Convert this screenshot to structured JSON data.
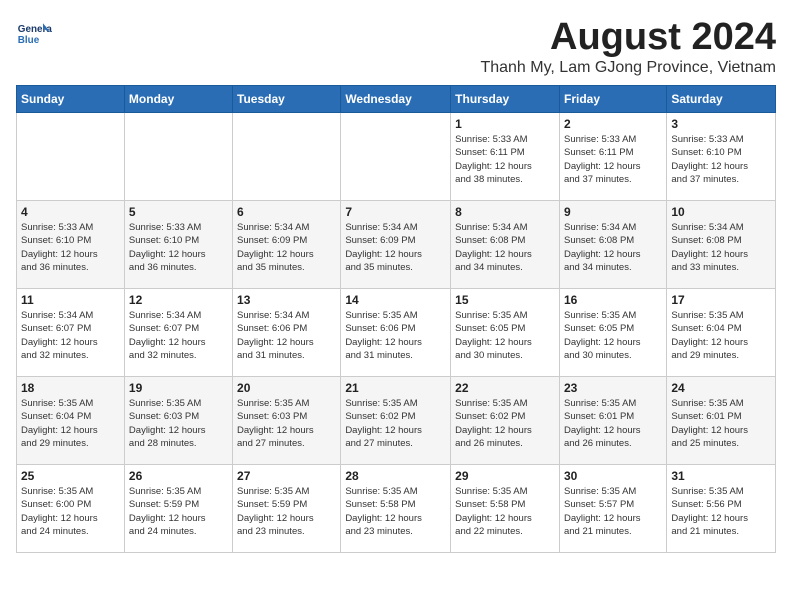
{
  "header": {
    "logo_line1": "General",
    "logo_line2": "Blue",
    "month_year": "August 2024",
    "location": "Thanh My, Lam GJong Province, Vietnam"
  },
  "weekdays": [
    "Sunday",
    "Monday",
    "Tuesday",
    "Wednesday",
    "Thursday",
    "Friday",
    "Saturday"
  ],
  "weeks": [
    [
      {
        "day": "",
        "info": ""
      },
      {
        "day": "",
        "info": ""
      },
      {
        "day": "",
        "info": ""
      },
      {
        "day": "",
        "info": ""
      },
      {
        "day": "1",
        "info": "Sunrise: 5:33 AM\nSunset: 6:11 PM\nDaylight: 12 hours\nand 38 minutes."
      },
      {
        "day": "2",
        "info": "Sunrise: 5:33 AM\nSunset: 6:11 PM\nDaylight: 12 hours\nand 37 minutes."
      },
      {
        "day": "3",
        "info": "Sunrise: 5:33 AM\nSunset: 6:10 PM\nDaylight: 12 hours\nand 37 minutes."
      }
    ],
    [
      {
        "day": "4",
        "info": "Sunrise: 5:33 AM\nSunset: 6:10 PM\nDaylight: 12 hours\nand 36 minutes."
      },
      {
        "day": "5",
        "info": "Sunrise: 5:33 AM\nSunset: 6:10 PM\nDaylight: 12 hours\nand 36 minutes."
      },
      {
        "day": "6",
        "info": "Sunrise: 5:34 AM\nSunset: 6:09 PM\nDaylight: 12 hours\nand 35 minutes."
      },
      {
        "day": "7",
        "info": "Sunrise: 5:34 AM\nSunset: 6:09 PM\nDaylight: 12 hours\nand 35 minutes."
      },
      {
        "day": "8",
        "info": "Sunrise: 5:34 AM\nSunset: 6:08 PM\nDaylight: 12 hours\nand 34 minutes."
      },
      {
        "day": "9",
        "info": "Sunrise: 5:34 AM\nSunset: 6:08 PM\nDaylight: 12 hours\nand 34 minutes."
      },
      {
        "day": "10",
        "info": "Sunrise: 5:34 AM\nSunset: 6:08 PM\nDaylight: 12 hours\nand 33 minutes."
      }
    ],
    [
      {
        "day": "11",
        "info": "Sunrise: 5:34 AM\nSunset: 6:07 PM\nDaylight: 12 hours\nand 32 minutes."
      },
      {
        "day": "12",
        "info": "Sunrise: 5:34 AM\nSunset: 6:07 PM\nDaylight: 12 hours\nand 32 minutes."
      },
      {
        "day": "13",
        "info": "Sunrise: 5:34 AM\nSunset: 6:06 PM\nDaylight: 12 hours\nand 31 minutes."
      },
      {
        "day": "14",
        "info": "Sunrise: 5:35 AM\nSunset: 6:06 PM\nDaylight: 12 hours\nand 31 minutes."
      },
      {
        "day": "15",
        "info": "Sunrise: 5:35 AM\nSunset: 6:05 PM\nDaylight: 12 hours\nand 30 minutes."
      },
      {
        "day": "16",
        "info": "Sunrise: 5:35 AM\nSunset: 6:05 PM\nDaylight: 12 hours\nand 30 minutes."
      },
      {
        "day": "17",
        "info": "Sunrise: 5:35 AM\nSunset: 6:04 PM\nDaylight: 12 hours\nand 29 minutes."
      }
    ],
    [
      {
        "day": "18",
        "info": "Sunrise: 5:35 AM\nSunset: 6:04 PM\nDaylight: 12 hours\nand 29 minutes."
      },
      {
        "day": "19",
        "info": "Sunrise: 5:35 AM\nSunset: 6:03 PM\nDaylight: 12 hours\nand 28 minutes."
      },
      {
        "day": "20",
        "info": "Sunrise: 5:35 AM\nSunset: 6:03 PM\nDaylight: 12 hours\nand 27 minutes."
      },
      {
        "day": "21",
        "info": "Sunrise: 5:35 AM\nSunset: 6:02 PM\nDaylight: 12 hours\nand 27 minutes."
      },
      {
        "day": "22",
        "info": "Sunrise: 5:35 AM\nSunset: 6:02 PM\nDaylight: 12 hours\nand 26 minutes."
      },
      {
        "day": "23",
        "info": "Sunrise: 5:35 AM\nSunset: 6:01 PM\nDaylight: 12 hours\nand 26 minutes."
      },
      {
        "day": "24",
        "info": "Sunrise: 5:35 AM\nSunset: 6:01 PM\nDaylight: 12 hours\nand 25 minutes."
      }
    ],
    [
      {
        "day": "25",
        "info": "Sunrise: 5:35 AM\nSunset: 6:00 PM\nDaylight: 12 hours\nand 24 minutes."
      },
      {
        "day": "26",
        "info": "Sunrise: 5:35 AM\nSunset: 5:59 PM\nDaylight: 12 hours\nand 24 minutes."
      },
      {
        "day": "27",
        "info": "Sunrise: 5:35 AM\nSunset: 5:59 PM\nDaylight: 12 hours\nand 23 minutes."
      },
      {
        "day": "28",
        "info": "Sunrise: 5:35 AM\nSunset: 5:58 PM\nDaylight: 12 hours\nand 23 minutes."
      },
      {
        "day": "29",
        "info": "Sunrise: 5:35 AM\nSunset: 5:58 PM\nDaylight: 12 hours\nand 22 minutes."
      },
      {
        "day": "30",
        "info": "Sunrise: 5:35 AM\nSunset: 5:57 PM\nDaylight: 12 hours\nand 21 minutes."
      },
      {
        "day": "31",
        "info": "Sunrise: 5:35 AM\nSunset: 5:56 PM\nDaylight: 12 hours\nand 21 minutes."
      }
    ]
  ]
}
